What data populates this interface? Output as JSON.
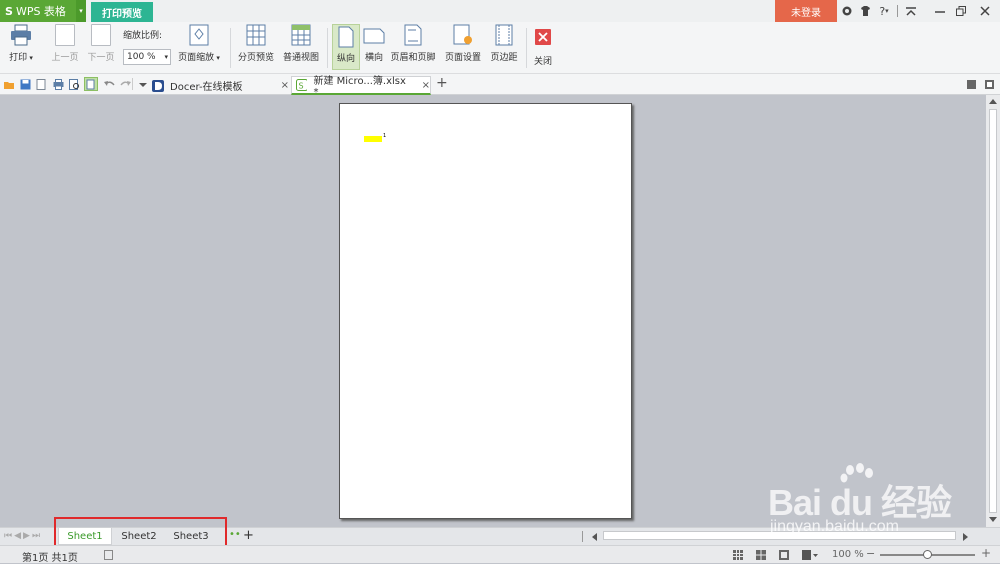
{
  "titlebar": {
    "app_logo": "S",
    "app_name": "WPS 表格",
    "app_dropdown": "▾",
    "active_tab": "打印预览",
    "login": "未登录",
    "help": "?",
    "icons": [
      "skin-icon",
      "shirt-icon",
      "help-icon",
      "collapse-icon",
      "minimize-icon",
      "restore-icon",
      "close-icon"
    ]
  },
  "ribbon": {
    "print": "打印",
    "prev_page": "上一页",
    "next_page": "下一页",
    "zoom_label": "缩放比例:",
    "zoom_value": "100 %",
    "page_zoom": "页面缩放",
    "page_break_preview": "分页预览",
    "normal_view": "普通视图",
    "portrait": "纵向",
    "landscape": "横向",
    "header_footer": "页眉和页脚",
    "page_setup": "页面设置",
    "margins": "页边距",
    "close": "关闭"
  },
  "doc_tabs": [
    {
      "label": "Docer-在线模板",
      "close": "×"
    },
    {
      "label": "新建 Micro...簿.xlsx *",
      "close": "×"
    }
  ],
  "new_tab": "+",
  "sheet_tabs": [
    "Sheet1",
    "Sheet2",
    "Sheet3"
  ],
  "add_sheet": "+",
  "status": {
    "page_info": "第1页 共1页",
    "zoom": "100 %",
    "zoom_level": 0.5
  },
  "watermark": {
    "main": "Bai du 经验",
    "sub": "jingyan.baidu.com"
  },
  "colors": {
    "app_green": "#5aa735",
    "tab_teal": "#2db593",
    "login_orange": "#e5674a",
    "highlight_yellow": "#ffff00",
    "annotation_red": "#e0292b"
  }
}
